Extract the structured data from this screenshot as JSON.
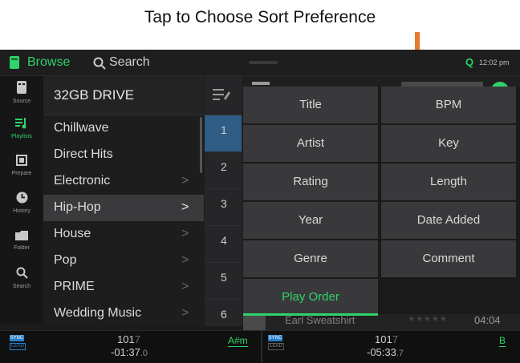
{
  "annotation": {
    "text": "Tap to Choose Sort Preference",
    "arrow_color": "#e8782a"
  },
  "topbar": {
    "browse_label": "Browse",
    "search_label": "Search",
    "queue_label": "Q",
    "time": "12:02 pm"
  },
  "sidebar": {
    "items": [
      {
        "label": "Source",
        "icon": "drive-icon"
      },
      {
        "label": "Playlists",
        "icon": "playlist-icon"
      },
      {
        "label": "Prepare",
        "icon": "prepare-icon"
      },
      {
        "label": "History",
        "icon": "history-icon"
      },
      {
        "label": "Folder",
        "icon": "folder-icon"
      },
      {
        "label": "Search",
        "icon": "search-icon"
      }
    ]
  },
  "panel": {
    "title": "32GB DRIVE",
    "playlists": [
      "Chillwave",
      "Direct Hits",
      "Electronic",
      "Hip-Hop",
      "House",
      "Pop",
      "PRIME",
      "Wedding Music"
    ],
    "selected_playlist": "Hip-Hop"
  },
  "track_numbers": [
    "1",
    "2",
    "3",
    "4",
    "5",
    "6"
  ],
  "sort_menu": {
    "options": [
      "Title",
      "BPM",
      "Artist",
      "Key",
      "Rating",
      "Length",
      "Year",
      "Date Added",
      "Genre",
      "Comment",
      "Play Order"
    ],
    "active": "Play Order"
  },
  "visible_track": {
    "artist": "Earl Sweatshirt",
    "duration": "04:04"
  },
  "decks": {
    "left": {
      "sync": "SYNC",
      "lead": "LEAD",
      "bpm_main": "101",
      "bpm_dec": "7",
      "remaining_main": "-01:37",
      "remaining_dec": ".0",
      "key": "A#m"
    },
    "right": {
      "sync": "SYNC",
      "lead": "LEAD",
      "bpm_main": "101",
      "bpm_dec": "7",
      "remaining_main": "-05:33",
      "remaining_dec": ".7",
      "key": "B"
    }
  },
  "colors": {
    "accent_green": "#2fd36a",
    "sync_blue": "#2a7fc9",
    "highlight_blue": "#2f5d86"
  }
}
